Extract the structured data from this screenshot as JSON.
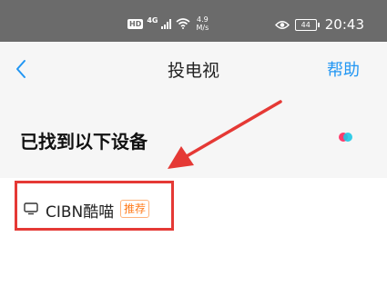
{
  "status_bar": {
    "hd": "HD",
    "network": "4G",
    "speed_value": "4.9",
    "speed_unit": "M/s",
    "battery": "44",
    "time": "20:43"
  },
  "header": {
    "back_icon": "chevron-left-icon",
    "title": "投电视",
    "help_label": "帮助"
  },
  "section": {
    "title": "已找到以下设备",
    "loading_icon": "loading-dots-icon"
  },
  "devices": [
    {
      "name": "CIBN酷喵",
      "badge": "推荐",
      "icon": "tv-icon"
    }
  ],
  "colors": {
    "accent": "#2196f3",
    "badge": "#ff7a1a",
    "annotation_red": "#e53935",
    "status_bar_bg": "#6b6b6b",
    "loading_dot_1": "#ff3b6b",
    "loading_dot_2": "#1ec8e6"
  }
}
